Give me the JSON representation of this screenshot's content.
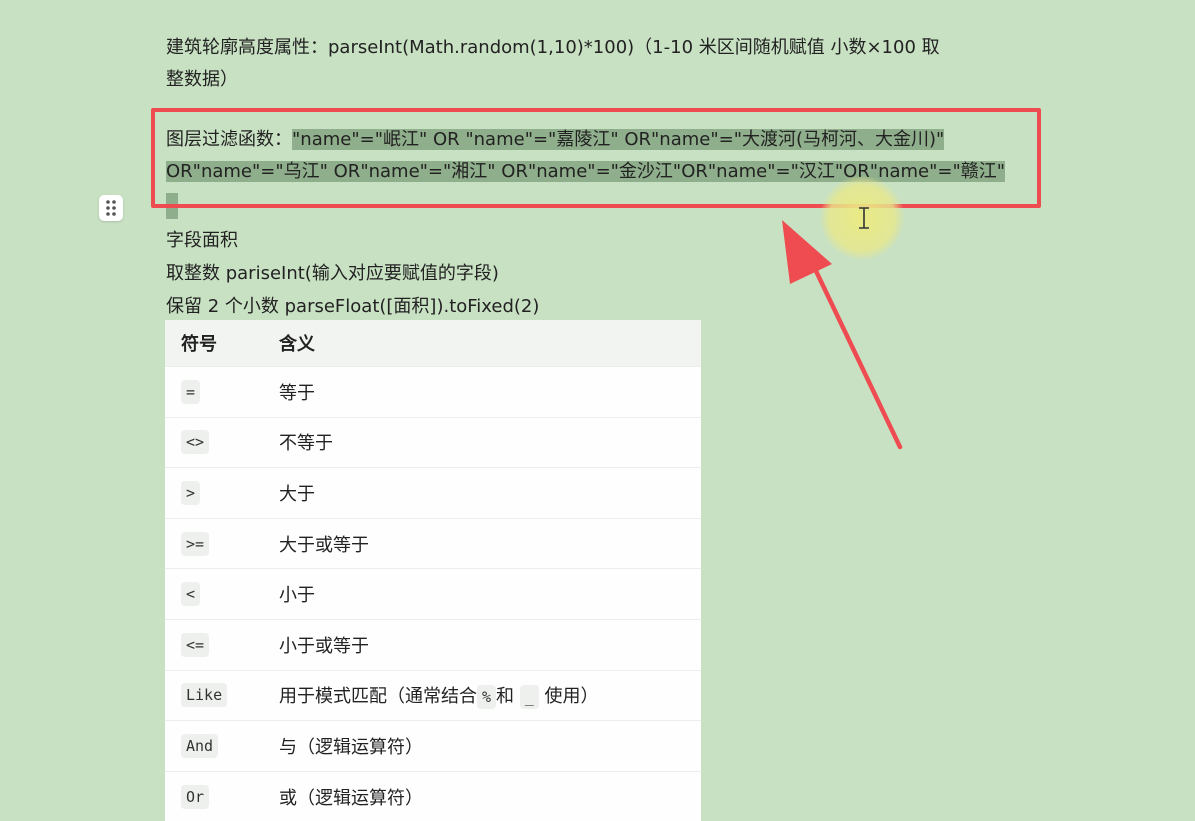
{
  "doc": {
    "height_attr_label": "建筑轮廓高度属性：parseInt(Math.random(1,10)*100)（1-10 米区间随机赋值  小数×100  取",
    "height_attr_cont": "整数据）",
    "filter_label": "图层过滤函数：",
    "filter_expr_line1": "\"name\"=\"岷江\" OR \"name\"=\"嘉陵江\" OR\"name\"=\"大渡河(马柯河、大金川)\"",
    "filter_expr_line2": "OR\"name\"=\"乌江\" OR\"name\"=\"湘江\" OR\"name\"=\"金沙江\"OR\"name\"=\"汉江\"OR\"name\"=\"赣江\"",
    "field_area": "字段面积",
    "round_int": "取整数  pariseInt(输入对应要赋值的字段)",
    "keep_two_decimals": "保留 2 个小数 parseFloat([面积]).toFixed(2)"
  },
  "table": {
    "headers": [
      "符号",
      "含义"
    ],
    "rows": [
      {
        "symbol": "=",
        "meaning": "等于"
      },
      {
        "symbol": "<>",
        "meaning": "不等于"
      },
      {
        "symbol": ">",
        "meaning": "大于"
      },
      {
        "symbol": ">=",
        "meaning": "大于或等于"
      },
      {
        "symbol": "<",
        "meaning": "小于"
      },
      {
        "symbol": "<=",
        "meaning": "小于或等于"
      },
      {
        "symbol": "Like",
        "meaning_pre": "用于模式匹配（通常结合",
        "code_a": "%",
        "meaning_mid": "和",
        "code_b": "_",
        "meaning_post": "使用）"
      },
      {
        "symbol": "And",
        "meaning": "与（逻辑运算符）"
      },
      {
        "symbol": "Or",
        "meaning": "或（逻辑运算符）"
      }
    ]
  },
  "icons": {
    "drag": "drag-handle-icon",
    "cursor": "text-cursor-icon",
    "arrow": "annotation-arrow-icon"
  },
  "colors": {
    "background": "#c8e1c3",
    "highlight": "#8fae8b",
    "annotation_red": "#ef4c52",
    "cursor_glow": "#ecea80"
  }
}
